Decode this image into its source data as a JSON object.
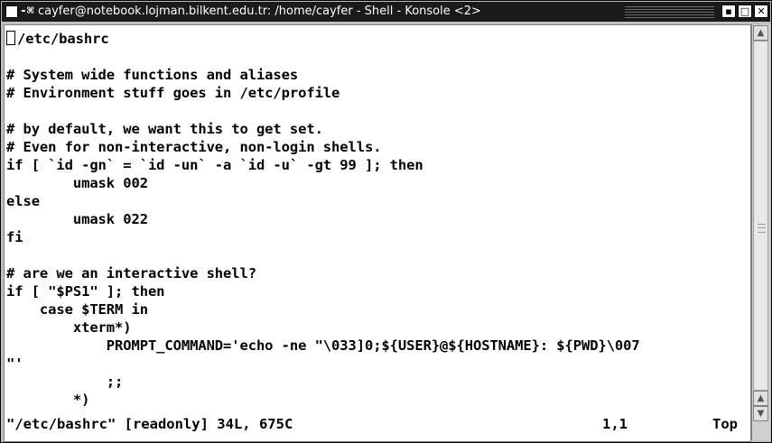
{
  "window": {
    "title": "cayfer@notebook.lojman.bilkent.edu.tr: /home/cayfer - Shell - Konsole <2>",
    "app_icon": "konsole-icon"
  },
  "terminal": {
    "lines": [
      "/etc/bashrc",
      "",
      "# System wide functions and aliases",
      "# Environment stuff goes in /etc/profile",
      "",
      "# by default, we want this to get set.",
      "# Even for non-interactive, non-login shells.",
      "if [ `id -gn` = `id -un` -a `id -u` -gt 99 ]; then",
      "        umask 002",
      "else",
      "        umask 022",
      "fi",
      "",
      "# are we an interactive shell?",
      "if [ \"$PS1\" ]; then",
      "    case $TERM in",
      "        xterm*)",
      "            PROMPT_COMMAND='echo -ne \"\\033]0;${USER}@${HOSTNAME}: ${PWD}\\007",
      "\"'",
      "            ;;",
      "        *)"
    ],
    "status": {
      "file_info": "\"/etc/bashrc\" [readonly] 34L, 675C",
      "position": "1,1",
      "scroll": "Top"
    }
  },
  "colors": {
    "titlebar_bg": "#1a1a1a",
    "terminal_bg": "#ffffff",
    "terminal_fg": "#000000"
  }
}
